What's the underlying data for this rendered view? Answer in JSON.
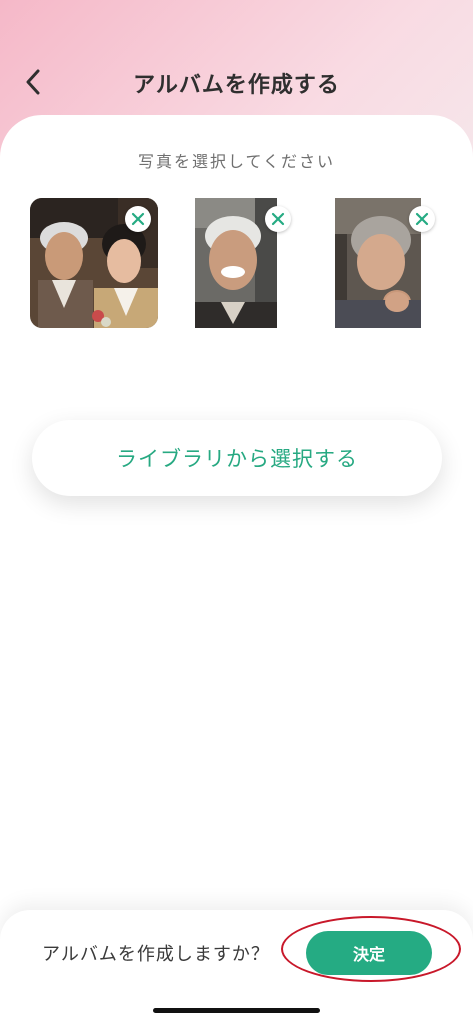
{
  "header": {
    "title": "アルバムを作成する",
    "back_icon": "chevron-left-icon"
  },
  "selection": {
    "prompt": "写真を選択してください",
    "remove_icon": "close-icon",
    "photos": [
      {
        "description_icon": "photo-thumbnail-couple"
      },
      {
        "description_icon": "photo-thumbnail-old-man"
      },
      {
        "description_icon": "photo-thumbnail-old-woman"
      }
    ]
  },
  "library_button": {
    "label": "ライブラリから選択する"
  },
  "footer": {
    "question": "アルバムを作成しますか？",
    "confirm_label": "決定"
  },
  "colors": {
    "accent": "#25ab83",
    "accent_text": "#27a982",
    "highlight": "#c8182a"
  }
}
